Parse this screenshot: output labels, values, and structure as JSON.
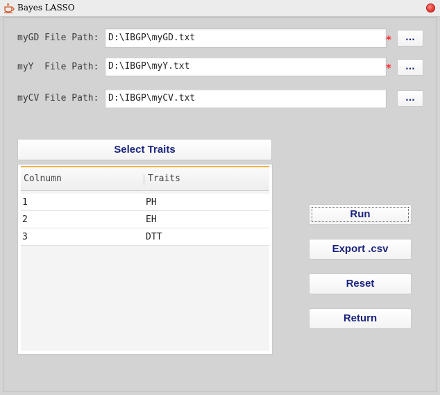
{
  "window": {
    "title": "Bayes LASSO",
    "app_icon": "coffee-cup-icon",
    "close_icon": "close-icon",
    "close_color": "#e53935"
  },
  "form": {
    "mygd": {
      "label": "myGD File Path:",
      "value": "D:\\IBGP\\myGD.txt",
      "required": "*",
      "browse_label": "..."
    },
    "myy": {
      "label": "myY  File Path:",
      "value": "D:\\IBGP\\myY.txt",
      "required": "*",
      "browse_label": "..."
    },
    "mycv": {
      "label": "myCV File Path:",
      "value": "D:\\IBGP\\myCV.txt",
      "browse_label": "..."
    }
  },
  "traits": {
    "button_label": "Select Traits",
    "columns": [
      "Colnumn",
      "Traits"
    ],
    "rows": [
      {
        "col": "1",
        "trait": "PH"
      },
      {
        "col": "2",
        "trait": "EH"
      },
      {
        "col": "3",
        "trait": "DTT"
      }
    ]
  },
  "actions": {
    "run": "Run",
    "export": "Export .csv",
    "reset": "Reset",
    "return": "Return"
  },
  "colors": {
    "accent_text": "#1a237e",
    "required": "#ff2a2a",
    "header_highlight": "#f0b040"
  }
}
